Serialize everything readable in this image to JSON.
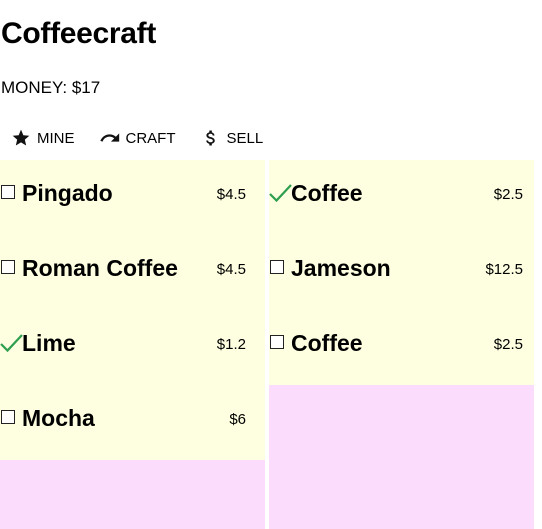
{
  "app": {
    "title": "Coffeecraft",
    "money": "MONEY: $17"
  },
  "toolbar": {
    "mine": {
      "label": "MINE",
      "icon": "star-icon"
    },
    "craft": {
      "label": "CRAFT",
      "icon": "redo-arrow-icon"
    },
    "sell": {
      "label": "SELL",
      "icon": "dollar-icon"
    }
  },
  "inventory": {
    "left": [
      {
        "name": "Pingado",
        "price": "$4.5",
        "checked": false
      },
      {
        "name": "Roman Coffee",
        "price": "$4.5",
        "checked": false
      },
      {
        "name": "Lime",
        "price": "$1.2",
        "checked": true
      },
      {
        "name": "Mocha",
        "price": "$6",
        "checked": false
      }
    ],
    "right": [
      {
        "name": "Coffee",
        "price": "$2.5",
        "checked": true
      },
      {
        "name": "Jameson",
        "price": "$12.5",
        "checked": false
      },
      {
        "name": "Coffee",
        "price": "$2.5",
        "checked": false
      }
    ]
  },
  "colors": {
    "item_bg": "#fefee0",
    "column_bg": "#fcdcfc",
    "check_green": "#2e9e4f"
  }
}
